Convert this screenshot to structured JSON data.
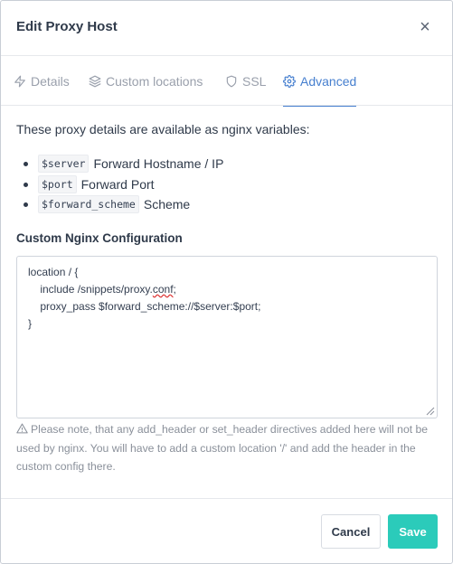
{
  "modal": {
    "title": "Edit Proxy Host",
    "close_symbol": "×"
  },
  "tabs": [
    {
      "label": "Details",
      "icon": "zap-icon",
      "active": false
    },
    {
      "label": "Custom locations",
      "icon": "layers-icon",
      "active": false
    },
    {
      "label": "SSL",
      "icon": "shield-icon",
      "active": false
    },
    {
      "label": "Advanced",
      "icon": "settings-icon",
      "active": true
    }
  ],
  "advanced": {
    "intro": "These proxy details are available as nginx variables:",
    "variables": [
      {
        "code": "$server",
        "desc": "Forward Hostname / IP"
      },
      {
        "code": "$port",
        "desc": "Forward Port"
      },
      {
        "code": "$forward_scheme",
        "desc": "Scheme"
      }
    ],
    "config_label": "Custom Nginx Configuration",
    "config_lines": [
      "location / {",
      "    include /snippets/proxy.",
      "    proxy_pass $forward_scheme://$server:$port;",
      "}"
    ],
    "config_squiggle_word": "conf",
    "config_line2_suffix": ";",
    "note": "Please note, that any add_header or set_header directives added here will not be used by nginx. You will have to add a custom location '/' and add the header in the custom config there."
  },
  "footer": {
    "cancel_label": "Cancel",
    "save_label": "Save"
  },
  "colors": {
    "accent": "#467fcf",
    "save": "#2bcbba"
  }
}
